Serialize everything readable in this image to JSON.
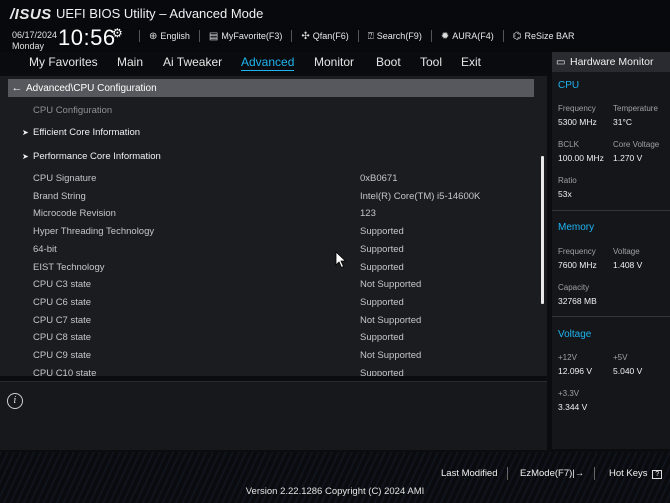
{
  "header": {
    "logo": "/ISUS",
    "title": "UEFI BIOS Utility – Advanced Mode",
    "date": "06/17/2024",
    "day": "Monday",
    "time": "10:56",
    "toolbar": [
      {
        "icon": "globe-icon",
        "label": "English"
      },
      {
        "icon": "favorite-icon",
        "label": "MyFavorite(F3)"
      },
      {
        "icon": "fan-icon",
        "label": "Qfan(F6)"
      },
      {
        "icon": "search-icon",
        "label": "Search(F9)"
      },
      {
        "icon": "aura-icon",
        "label": "AURA(F4)"
      },
      {
        "icon": "resize-bar-icon",
        "label": "ReSize BAR"
      }
    ]
  },
  "nav": {
    "items": [
      "My Favorites",
      "Main",
      "Ai Tweaker",
      "Advanced",
      "Monitor",
      "Boot",
      "Tool",
      "Exit"
    ],
    "active": "Advanced"
  },
  "main": {
    "breadcrumb": "Advanced\\CPU Configuration",
    "section_title": "CPU Configuration",
    "submenus": [
      "Efficient Core Information",
      "Performance Core Information"
    ],
    "rows": [
      {
        "label": "CPU Signature",
        "value": "0xB0671"
      },
      {
        "label": "Brand String",
        "value": "Intel(R) Core(TM) i5-14600K"
      },
      {
        "label": "Microcode Revision",
        "value": "123"
      },
      {
        "label": "Hyper Threading Technology",
        "value": "Supported"
      },
      {
        "label": "64-bit",
        "value": "Supported"
      },
      {
        "label": "EIST Technology",
        "value": "Supported"
      },
      {
        "label": "CPU C3 state",
        "value": "Not Supported"
      },
      {
        "label": "CPU C6 state",
        "value": "Supported"
      },
      {
        "label": "CPU C7 state",
        "value": "Not Supported"
      },
      {
        "label": "CPU C8 state",
        "value": "Supported"
      },
      {
        "label": "CPU C9 state",
        "value": "Not Supported"
      },
      {
        "label": "CPU C10 state",
        "value": "Supported"
      }
    ]
  },
  "hw_monitor": {
    "title": "Hardware Monitor",
    "cpu": {
      "title": "CPU",
      "frequency_label": "Frequency",
      "frequency": "5300 MHz",
      "temperature_label": "Temperature",
      "temperature": "31°C",
      "bclk_label": "BCLK",
      "bclk": "100.00 MHz",
      "core_voltage_label": "Core Voltage",
      "core_voltage": "1.270 V",
      "ratio_label": "Ratio",
      "ratio": "53x"
    },
    "memory": {
      "title": "Memory",
      "frequency_label": "Frequency",
      "frequency": "7600 MHz",
      "voltage_label": "Voltage",
      "voltage": "1.408 V",
      "capacity_label": "Capacity",
      "capacity": "32768 MB"
    },
    "voltage": {
      "title": "Voltage",
      "v12_label": "+12V",
      "v12": "12.096 V",
      "v5_label": "+5V",
      "v5": "5.040 V",
      "v33_label": "+3.3V",
      "v33": "3.344 V"
    }
  },
  "footer": {
    "last_modified": "Last Modified",
    "ezmode": "EzMode(F7)|",
    "hotkeys": "Hot Keys",
    "version": "Version 2.22.1286 Copyright (C) 2024 AMI"
  },
  "colors": {
    "accent": "#1fb4f0",
    "panel": "#1b1c20",
    "highlight": "#56585d"
  }
}
